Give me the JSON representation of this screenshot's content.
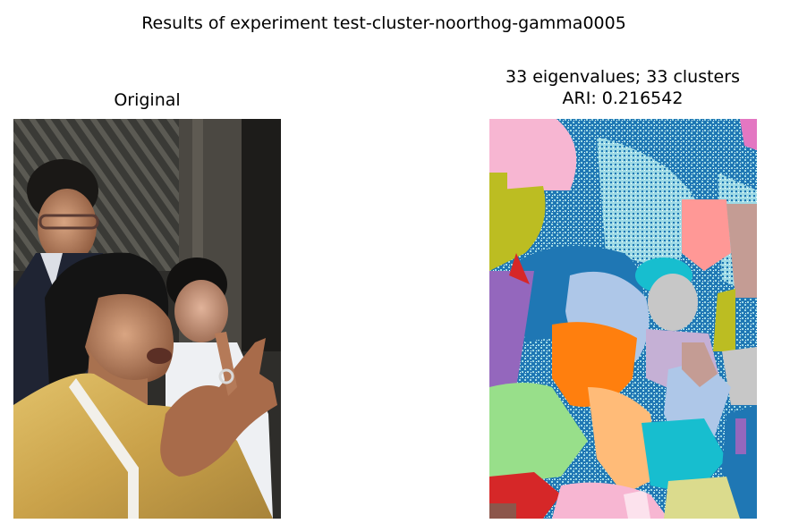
{
  "figure": {
    "suptitle": "Results of experiment test-cluster-noorthog-gamma0005"
  },
  "left_panel": {
    "title": "Original",
    "image_description_icon": "photo-icon"
  },
  "right_panel": {
    "title_line1": "33 eigenvalues; 33 clusters",
    "title_line2": "ARI: 0.216542",
    "image_description_icon": "segmentation-map-icon"
  },
  "colors": {
    "tab_blue": "#1f77b4",
    "tab_orange": "#ff7f0e",
    "tab_green_light": "#98df8a",
    "tab_red": "#d62728",
    "tab_purple": "#9467bd",
    "tab_pink": "#f7b6d2",
    "tab_olive": "#bcbd22",
    "tab_cyan": "#17becf",
    "tab_cyan_light": "#9edae5",
    "tab_peach": "#ffbb78",
    "tab_lavender": "#c5b0d5",
    "tab_salmon": "#ff9896",
    "tab_steel": "#aec7e8",
    "tab_gray": "#c7c7c7",
    "tab_khaki": "#dbdb8d",
    "tab_brown_light": "#c49c94"
  }
}
